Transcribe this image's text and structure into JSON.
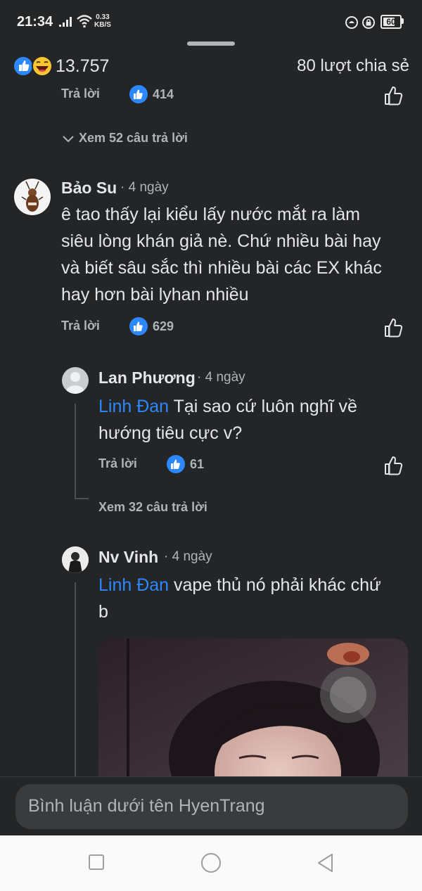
{
  "status_bar": {
    "time": "21:34",
    "speed_value": "0.33",
    "speed_unit": "KB/S",
    "battery": "60",
    "icons": [
      "signal-icon",
      "wifi-icon",
      "rotation-icon",
      "lock-icon",
      "battery-icon"
    ]
  },
  "reactions": {
    "icons": [
      "like-reaction-icon",
      "haha-reaction-icon"
    ],
    "count": "13.757",
    "shares": "80 lượt chia sẻ"
  },
  "comments": [
    {
      "id": "prev",
      "reply_label": "Trả lời",
      "likes": "414",
      "view_replies": "Xem 52 câu trả lời"
    },
    {
      "id": "bao-su",
      "author": "Bảo Su",
      "time": "· 4 ngày",
      "text_lines": [
        "ê tao thấy lại kiểu lấy nước mắt ra làm",
        "siêu lòng khán giả nè. Chứ nhiều bài hay",
        "và biết sâu sắc thì nhiều bài các EX khác",
        "hay hơn bài lyhan nhiều"
      ],
      "reply_label": "Trả lời",
      "likes": "629"
    }
  ],
  "replies": [
    {
      "id": "lan-phuong",
      "author": "Lan Phương",
      "time": "· 4 ngày",
      "mention": "Linh Đan",
      "text_line1": " Tại sao cứ luôn nghĩ về",
      "text_line2": "hướng tiêu cực v?",
      "reply_label": "Trả lời",
      "likes": "61",
      "view_replies": "Xem 32 câu trả lời"
    },
    {
      "id": "nv-vinh",
      "author": "Nv Vinh",
      "time": "· 4 ngày",
      "mention": "Linh Đan",
      "text_line1": " vape thủ nó phải khác chứ",
      "text_line2": "b"
    }
  ],
  "composer": {
    "placeholder": "Bình luận dưới tên HyenTrang"
  },
  "colors": {
    "background": "#242526",
    "accent": "#2d88ff",
    "secondary_text": "#b0b3b8"
  }
}
